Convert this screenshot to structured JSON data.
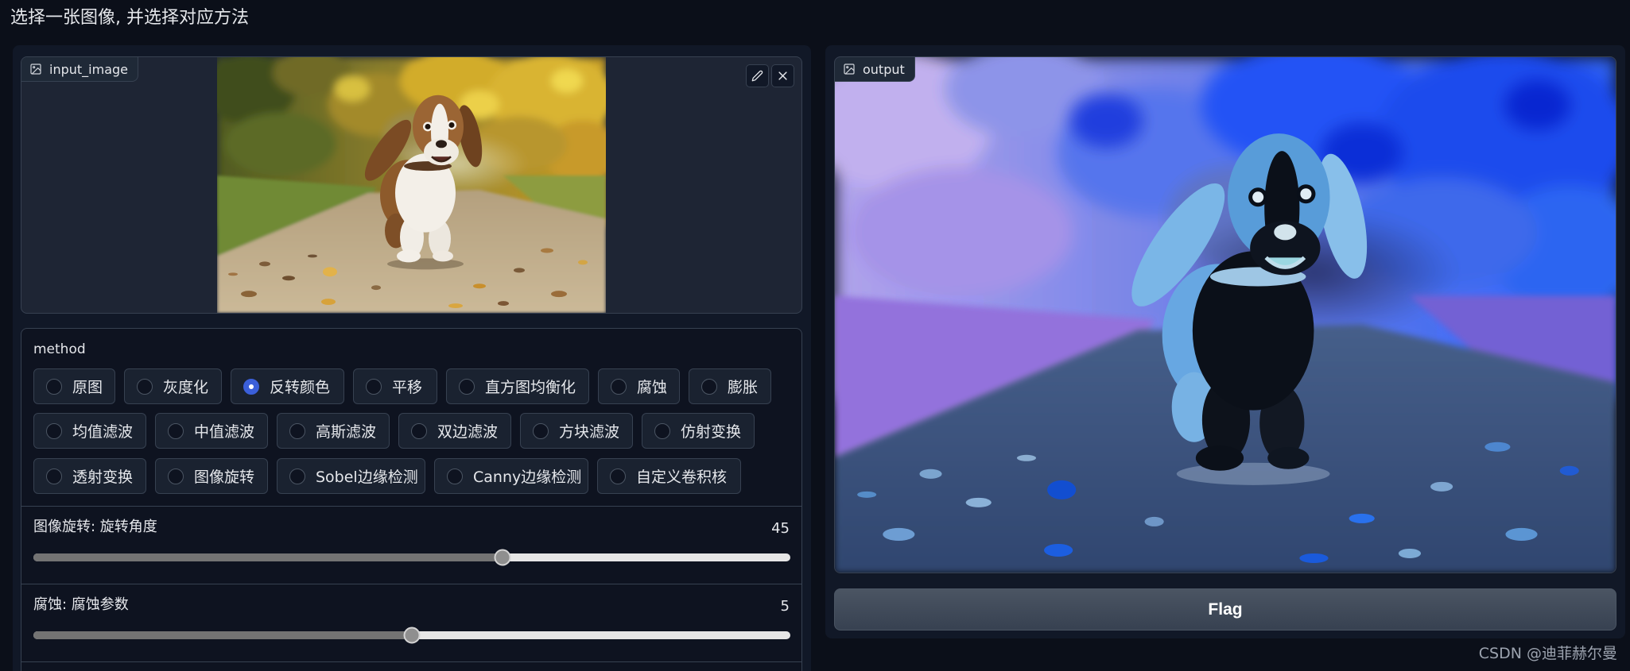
{
  "page": {
    "heading": "选择一张图像, 并选择对应方法"
  },
  "colors": {
    "background": "#0b0f19",
    "panel": "#111827",
    "border": "#374151",
    "accent": "#3b5fd9",
    "text": "#e5e7eb"
  },
  "input_image": {
    "label": "input_image",
    "label_icon": "image-icon",
    "edit_icon": "pencil-icon",
    "clear_icon": "close-icon"
  },
  "method": {
    "label": "method",
    "selected": "反转颜色",
    "options": [
      "原图",
      "灰度化",
      "反转颜色",
      "平移",
      "直方图均衡化",
      "腐蚀",
      "膨胀",
      "均值滤波",
      "中值滤波",
      "高斯滤波",
      "双边滤波",
      "方块滤波",
      "仿射变换",
      "透射变换",
      "图像旋转",
      "Sobel边缘检测",
      "Canny边缘检测",
      "自定义卷积核"
    ]
  },
  "sliders": [
    {
      "label": "图像旋转: 旋转角度",
      "value": "45",
      "fill_fraction": 0.62
    },
    {
      "label": "腐蚀: 腐蚀参数",
      "value": "5",
      "fill_fraction": 0.5
    }
  ],
  "output_image": {
    "label": "output",
    "label_icon": "image-icon"
  },
  "flag_button": {
    "label": "Flag"
  },
  "watermark": "CSDN @迪菲赫尔曼"
}
